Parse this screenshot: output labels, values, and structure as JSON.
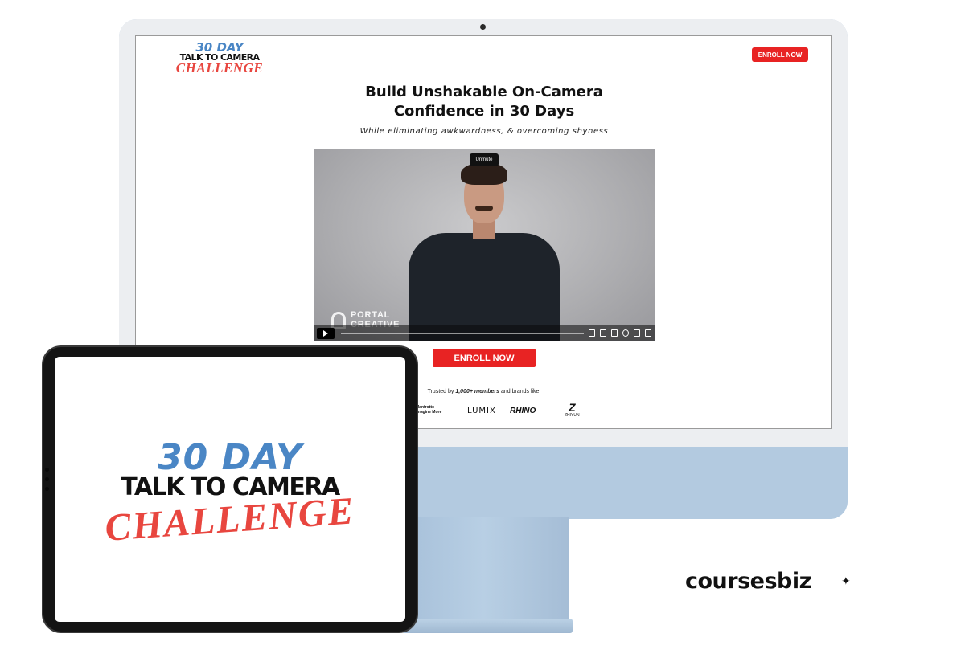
{
  "site": {
    "logo": {
      "line1": "30 DAY",
      "line2": "TALK TO CAMERA",
      "line3": "CHALLENGE"
    },
    "nav_enroll_label": "ENROLL NOW",
    "headline_line1": "Build Unshakable On-Camera",
    "headline_line2": "Confidence in 30 Days",
    "subheadline": "While eliminating awkwardness, & overcoming shyness",
    "video": {
      "unmute_label": "Unmute",
      "watermark_line1": "PORTAL",
      "watermark_line2": "CREATIVE",
      "progress": 0
    },
    "cta_label": "ENROLL NOW",
    "trusted": {
      "prefix": "Trusted by ",
      "emphasis": "1,000+ members",
      "suffix": " and brands like:"
    },
    "brands": {
      "manfrotto_line1": "Manfrotto",
      "manfrotto_line2": "Imagine More",
      "lumix": "LUMIX",
      "rhino": "RHINO",
      "zhiyun": "ZHIYUN"
    }
  },
  "ipad": {
    "line1": "30 DAY",
    "line2": "TALK TO CAMERA",
    "line3": "CHALLENGE"
  },
  "footer_brand": {
    "name": "coursesbiz",
    "mark": "✦"
  },
  "colors": {
    "accent_red": "#e82323",
    "logo_blue": "#4a86c5",
    "logo_red": "#e8463f",
    "imac_blue": "#b3cae0"
  },
  "icons": [
    "play-icon",
    "volume-icon",
    "captions-icon",
    "settings-icon",
    "pip-icon",
    "fullscreen-icon",
    "logo-mark-icon",
    "sparkle-icon"
  ]
}
